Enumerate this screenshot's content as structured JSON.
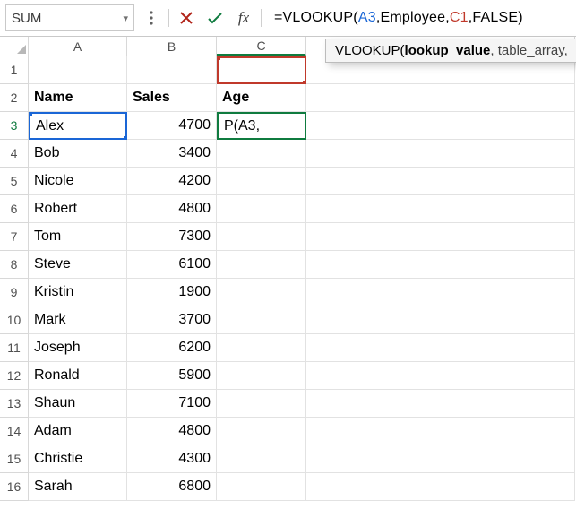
{
  "formula_bar": {
    "name_box": "SUM",
    "fx_label": "fx",
    "formula_prefix": "=VLOOKUP(",
    "arg1": "A3",
    "comma1": ",",
    "arg2": "Employee",
    "comma2": ",",
    "arg3": "C1",
    "comma3": ",",
    "arg4": "FALSE",
    "suffix": ")"
  },
  "tooltip": {
    "fn": "VLOOKUP(",
    "bold": "lookup_value",
    "rest": ", table_array, "
  },
  "columns": [
    "A",
    "B",
    "C",
    ""
  ],
  "headers": {
    "A": "Name",
    "B": "Sales",
    "C": "Age"
  },
  "active_cell_display": "P(A3,",
  "rows": [
    {
      "n": 3,
      "A": "Alex",
      "B": "4700"
    },
    {
      "n": 4,
      "A": "Bob",
      "B": "3400"
    },
    {
      "n": 5,
      "A": "Nicole",
      "B": "4200"
    },
    {
      "n": 6,
      "A": "Robert",
      "B": "4800"
    },
    {
      "n": 7,
      "A": "Tom",
      "B": "7300"
    },
    {
      "n": 8,
      "A": "Steve",
      "B": "6100"
    },
    {
      "n": 9,
      "A": "Kristin",
      "B": "1900"
    },
    {
      "n": 10,
      "A": "Mark",
      "B": "3700"
    },
    {
      "n": 11,
      "A": "Joseph",
      "B": "6200"
    },
    {
      "n": 12,
      "A": "Ronald",
      "B": "5900"
    },
    {
      "n": 13,
      "A": "Shaun",
      "B": "7100"
    },
    {
      "n": 14,
      "A": "Adam",
      "B": "4800"
    },
    {
      "n": 15,
      "A": "Christie",
      "B": "4300"
    },
    {
      "n": 16,
      "A": "Sarah",
      "B": "6800"
    }
  ]
}
